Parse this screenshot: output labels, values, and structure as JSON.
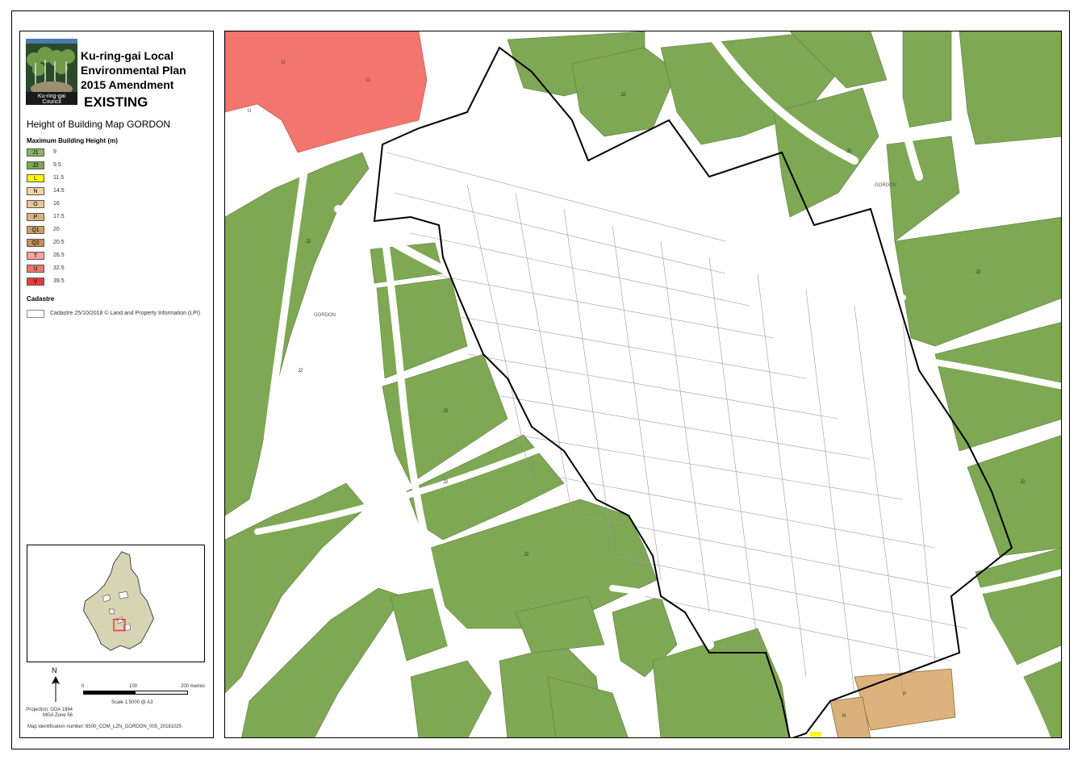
{
  "header": {
    "title_lines": [
      "Ku-ring-gai Local",
      "Environmental Plan",
      "2015 Amendment"
    ],
    "status": "EXISTING",
    "subtitle": "Height of Building Map GORDON",
    "logo_text": [
      "Ku-ring-gai",
      "Council"
    ]
  },
  "legend": {
    "heading": "Maximum Building Height (m)",
    "items": [
      {
        "code": "J1",
        "value": "9",
        "color": "#8bb35e"
      },
      {
        "code": "J2",
        "value": "9.5",
        "color": "#7ea853"
      },
      {
        "code": "L",
        "value": "11.5",
        "color": "#ffff00"
      },
      {
        "code": "N",
        "value": "14.5",
        "color": "#f3d5a6"
      },
      {
        "code": "O",
        "value": "16",
        "color": "#e8c797"
      },
      {
        "code": "P",
        "value": "17.5",
        "color": "#ddb27c"
      },
      {
        "code": "Q1",
        "value": "20",
        "color": "#cc9e62"
      },
      {
        "code": "Q2",
        "value": "20.5",
        "color": "#c49356"
      },
      {
        "code": "T",
        "value": "26.5",
        "color": "#f7a1a1"
      },
      {
        "code": "U",
        "value": "32.5",
        "color": "#f2756e"
      },
      {
        "code": "V",
        "value": "39.5",
        "color": "#e83c3c"
      }
    ],
    "cadastre_heading": "Cadastre",
    "cadastre_text": "Cadastre 25/10/2018 © Land and Property Information (LPI)"
  },
  "scale": {
    "north": "N",
    "ticks": [
      "0",
      "100",
      "200 metres"
    ],
    "scale_text": "Scale    1:5000    @ A3",
    "projection": [
      "Projection: GDA 1994",
      "MGA Zone 56"
    ],
    "map_id": "Map identification number:   6500_COM_LZN_GORDON_005_20181025"
  },
  "map_labels": {
    "zone_u": "U",
    "zone_j2": "J2",
    "zone_p": "P",
    "zone_n": "N",
    "zone_l": "L",
    "suburb": "GORDON"
  },
  "colors": {
    "green": "#7ea853",
    "red": "#f2756e",
    "tan": "#ddb27c",
    "road": "#ffffff"
  }
}
